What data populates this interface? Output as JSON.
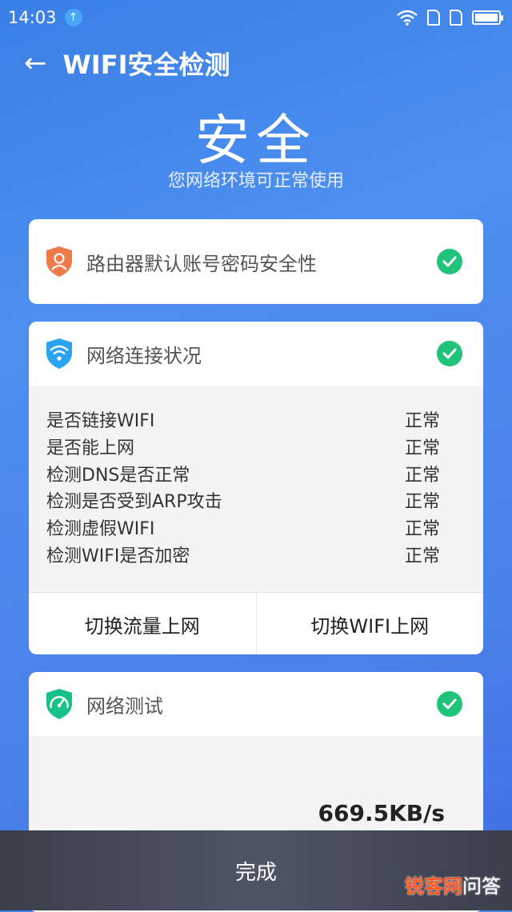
{
  "status_bar": {
    "time": "14:03"
  },
  "header": {
    "back_icon": "←",
    "title": "WIFI安全检测"
  },
  "result": {
    "status": "安全",
    "subtitle": "您网络环境可正常使用"
  },
  "cards": {
    "router": {
      "title": "路由器默认账号密码安全性"
    },
    "connection": {
      "title": "网络连接状况",
      "rows": [
        {
          "label": "是否链接WIFI",
          "value": "正常"
        },
        {
          "label": "是否能上网",
          "value": "正常"
        },
        {
          "label": "检测DNS是否正常",
          "value": "正常"
        },
        {
          "label": "检测是否受到ARP攻击",
          "value": "正常"
        },
        {
          "label": "检测虚假WIFI",
          "value": "正常"
        },
        {
          "label": "检测WIFI是否加密",
          "value": "正常"
        }
      ],
      "actions": {
        "mobile_data": "切换流量上网",
        "wifi": "切换WIFI上网"
      }
    },
    "speed_test": {
      "title": "网络测试",
      "speed": "669.5KB/s"
    }
  },
  "bottom": {
    "done": "完成"
  },
  "watermark": {
    "brand": "锐客网",
    "suffix": "问答"
  },
  "colors": {
    "accent_green": "#21c279",
    "router_orange": "#f07a4a",
    "wifi_blue": "#2aa3f0",
    "speed_green": "#18c08a"
  }
}
